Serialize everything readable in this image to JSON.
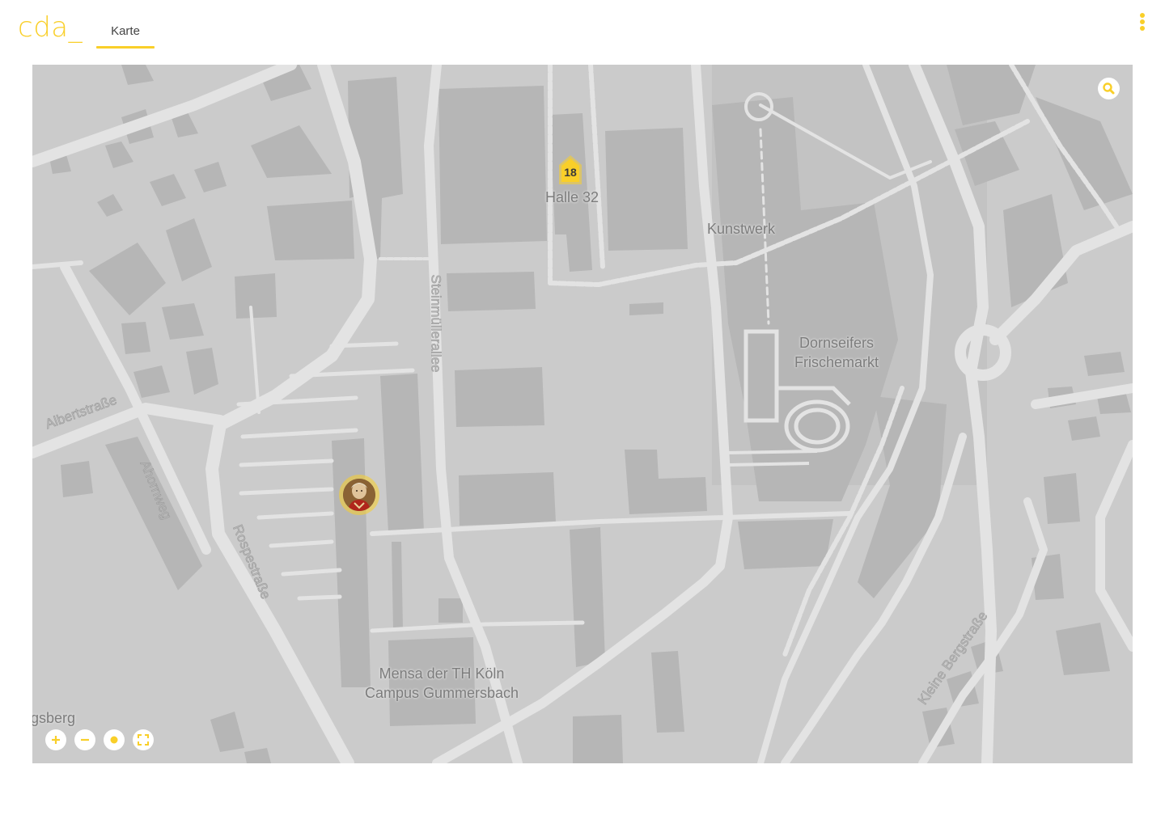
{
  "app": {
    "logo": "cda_",
    "tabs": [
      {
        "label": "Karte",
        "active": true
      }
    ],
    "accent_color": "#f9cf29"
  },
  "header": {
    "menu_icon": "more-vertical-icon"
  },
  "map": {
    "background_color": "#cbcbcb",
    "road_color": "#e3e3e3",
    "building_color": "#b8b8b8",
    "labels": {
      "halle": "Halle 32",
      "kunstwerk": "Kunstwerk",
      "dornseifers_line1": "Dornseifers",
      "dornseifers_line2": "Frischemarkt",
      "mensa_line1": "Mensa der TH Köln",
      "mensa_line2": "Campus Gummersbach",
      "partial_place": "gsberg"
    },
    "streets": {
      "steinmuellerallee": "Steinmüllerallee",
      "albertstrasse": "Albertstraße",
      "ahornweg": "Ahornweg",
      "rospestrasse": "Rospestraße",
      "kleine_bergstrasse": "Kleine Bergstraße"
    },
    "cluster_marker": {
      "count": "18",
      "icon": "house-marker-icon"
    },
    "avatar_marker": {
      "icon": "portrait-avatar-icon"
    },
    "search_icon": "search-icon",
    "controls": [
      {
        "name": "zoom-in",
        "icon": "plus-icon"
      },
      {
        "name": "zoom-out",
        "icon": "minus-icon"
      },
      {
        "name": "locate",
        "icon": "dot-icon"
      },
      {
        "name": "fullscreen",
        "icon": "fullscreen-icon"
      }
    ]
  }
}
